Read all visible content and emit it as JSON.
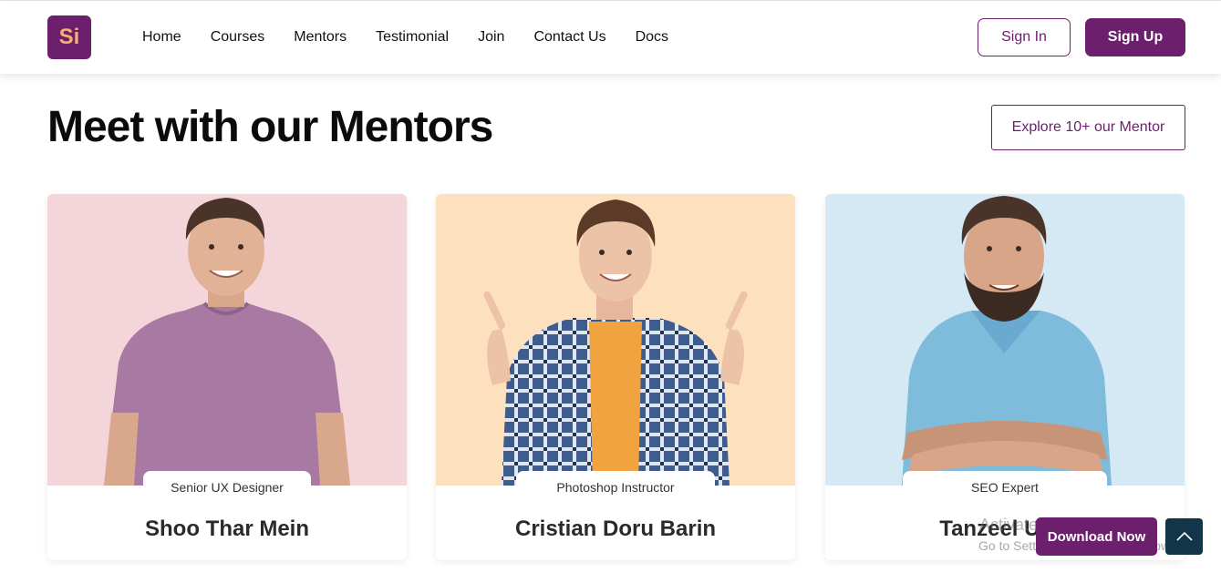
{
  "header": {
    "logo_text": "Si",
    "nav": [
      "Home",
      "Courses",
      "Mentors",
      "Testimonial",
      "Join",
      "Contact Us",
      "Docs"
    ],
    "sign_in": "Sign In",
    "sign_up": "Sign Up"
  },
  "section": {
    "title": "Meet with our Mentors",
    "explore_label": "Explore 10+ our Mentor"
  },
  "mentors": [
    {
      "role": "Senior UX Designer",
      "name": "Shoo Thar Mein"
    },
    {
      "role": "Photoshop Instructor",
      "name": "Cristian Doru Barin"
    },
    {
      "role": "SEO Expert",
      "name": "Tanzeel Ur R"
    }
  ],
  "floating": {
    "download_label": "Download Now",
    "scroll_top_icon": "chevron-up-icon"
  },
  "watermark": {
    "line1": "Activate Windows",
    "line2": "Go to Settings to activate Windows."
  },
  "colors": {
    "brand": "#6b1f6d",
    "logo_text": "#f4b26b",
    "card1_bg": "#f3d5da",
    "card2_bg": "#fde0bd",
    "card3_bg": "#d4e9f3",
    "scroll_top_bg": "#13354a"
  }
}
